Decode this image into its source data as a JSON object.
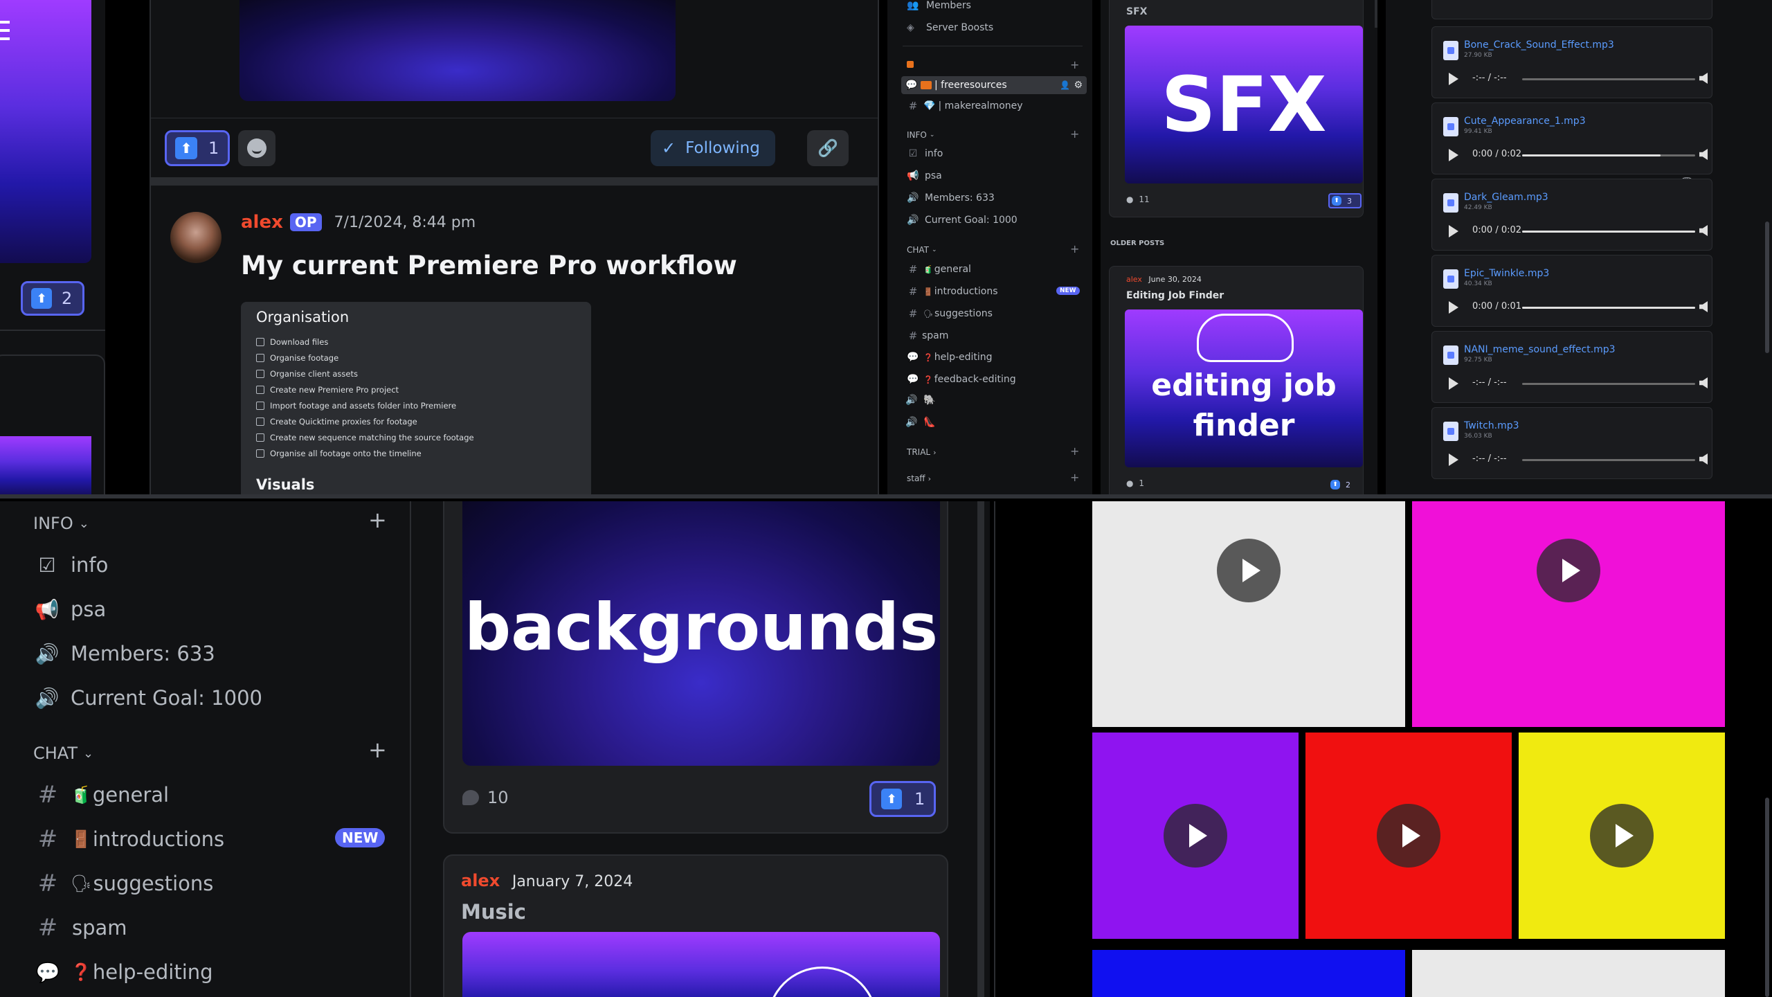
{
  "top_left": {
    "upvote_count": "2"
  },
  "post_header": {
    "upvote_count": "1",
    "following_label": "Following"
  },
  "post": {
    "author": "alex",
    "badge": "OP",
    "timestamp": "7/1/2024, 8:44 pm",
    "title": "My current Premiere Pro workflow",
    "card_heading": "Organisation",
    "checklist": [
      "Download files",
      "Organise footage",
      "Organise client assets",
      "Create new Premiere Pro project",
      "Import footage and assets folder into Premiere",
      "Create Quicktime proxies for footage",
      "Create new sequence matching the source footage",
      "Organise all footage onto the timeline"
    ],
    "card_subheading": "Visuals"
  },
  "small_sidebar": {
    "top_items": [
      "Members",
      "Server Boosts"
    ],
    "channel_selected": "| freeresources",
    "channel_second": "| makerealmoney",
    "info_header": "INFO",
    "info_items": [
      "info",
      "psa",
      "Members: 633",
      "Current Goal: 1000"
    ],
    "chat_header": "CHAT",
    "chat_items": [
      "general",
      "introductions",
      "suggestions",
      "spam",
      "help-editing",
      "feedback-editing"
    ],
    "new_badge": "NEW",
    "trial_header": "TRIAL",
    "staff_header": "staff"
  },
  "small_forum": {
    "sfx_label": "SFX",
    "sfx_image_text": "SFX",
    "sfx_comments": "11",
    "sfx_upvotes": "3",
    "older_posts_label": "OLDER POSTS",
    "older_author": "alex",
    "older_date": "June 30, 2024",
    "older_title": "Editing Job Finder",
    "older_image_text_1": "editing job",
    "older_image_text_2": "finder",
    "older_comments": "1",
    "older_upvotes": "2"
  },
  "audio_files": [
    {
      "name": "Bone_Crack_Sound_Effect.mp3",
      "size": "27.90 KB",
      "time": "-:-- / -:--",
      "progress": 0
    },
    {
      "name": "Cute_Appearance_1.mp3",
      "size": "99.41 KB",
      "time": "0:00 / 0:02",
      "progress": 0.8
    },
    {
      "name": "Dark_Gleam.mp3",
      "size": "42.49 KB",
      "time": "0:00 / 0:02",
      "progress": 1.0
    },
    {
      "name": "Epic_Twinkle.mp3",
      "size": "40.34 KB",
      "time": "0:00 / 0:01",
      "progress": 1.0
    },
    {
      "name": "NANI_meme_sound_effect.mp3",
      "size": "92.75 KB",
      "time": "-:-- / -:--",
      "progress": 0
    },
    {
      "name": "Twitch.mp3",
      "size": "36.03 KB",
      "time": "-:-- / -:--",
      "progress": 0
    }
  ],
  "big_sidebar": {
    "info_header": "INFO",
    "info_items": [
      "info",
      "psa",
      "Members: 633",
      "Current Goal: 1000"
    ],
    "chat_header": "CHAT",
    "chat_items": [
      "general",
      "introductions",
      "suggestions",
      "spam",
      "help-editing"
    ],
    "new_badge": "NEW"
  },
  "big_forum": {
    "image_text": "backgrounds",
    "comments": "10",
    "upvotes": "1",
    "next_author": "alex",
    "next_date": "January 7, 2024",
    "next_title": "Music"
  },
  "video_grid": {
    "colors": [
      "#e9e9e9",
      "#f010d8",
      "#8f14f0",
      "#f01010",
      "#f0ea10",
      "#1010f0",
      "#e9e9e9"
    ]
  }
}
